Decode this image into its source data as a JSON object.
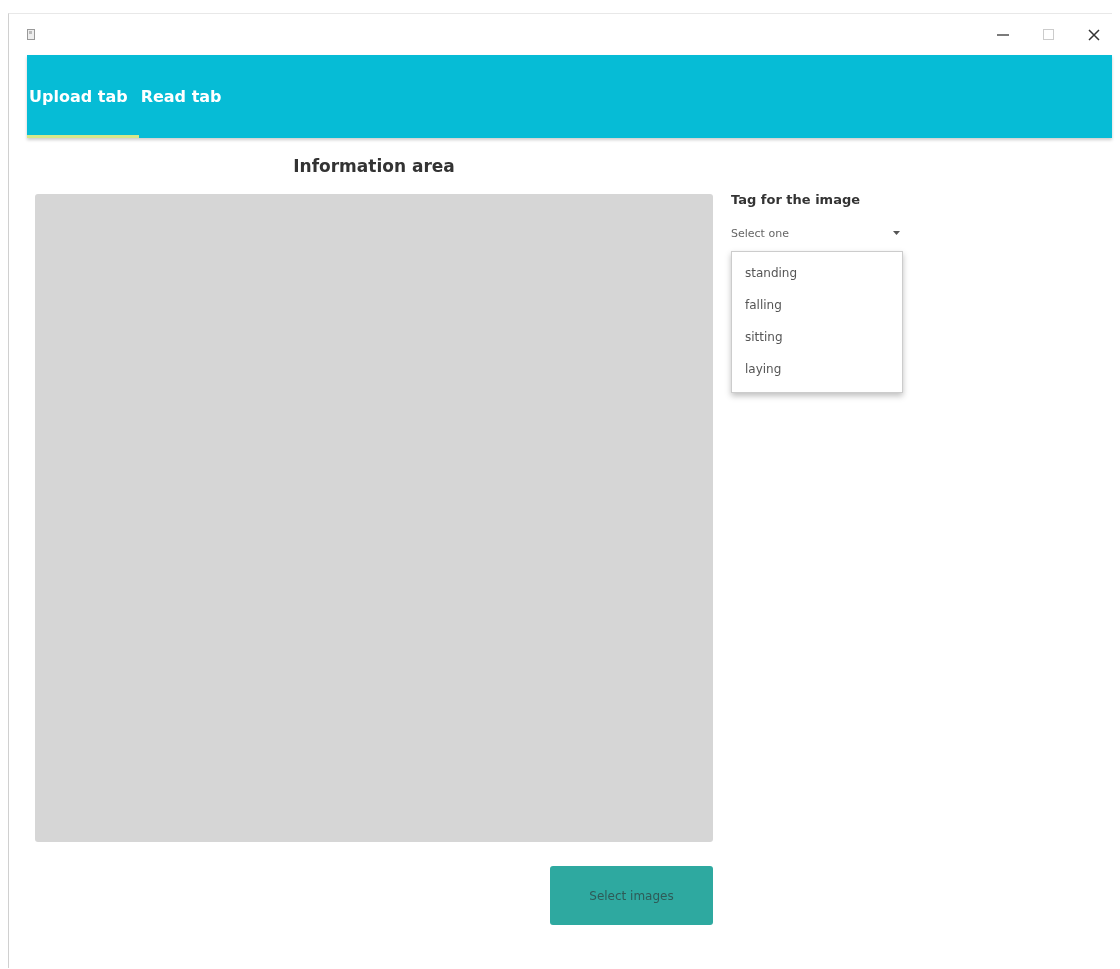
{
  "tabs": [
    {
      "label": "Upload tab",
      "selected": true
    },
    {
      "label": "Read tab",
      "selected": false
    }
  ],
  "heading": "Information area",
  "tag_select": {
    "label": "Tag for the image",
    "placeholder": "Select one",
    "expanded": true,
    "options": [
      "standing",
      "falling",
      "sitting",
      "laying"
    ]
  },
  "buttons": [
    "Select images"
  ]
}
